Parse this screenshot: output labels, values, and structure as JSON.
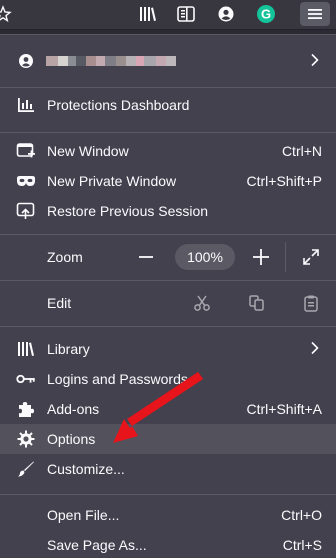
{
  "toolbar": {
    "icons": [
      "star-icon",
      "library-icon",
      "sidebar-icon",
      "account-icon",
      "grammarly-icon",
      "hamburger-menu-icon"
    ],
    "grammarly_letter": "G"
  },
  "menu": {
    "account": {
      "name_redacted": true
    },
    "protections": {
      "label": "Protections Dashboard"
    },
    "new_window": {
      "label": "New Window",
      "shortcut": "Ctrl+N"
    },
    "new_private": {
      "label": "New Private Window",
      "shortcut": "Ctrl+Shift+P"
    },
    "restore": {
      "label": "Restore Previous Session"
    },
    "zoom": {
      "label": "Zoom",
      "value": "100%",
      "minus": "−",
      "plus": "+"
    },
    "edit": {
      "label": "Edit"
    },
    "library": {
      "label": "Library"
    },
    "logins": {
      "label": "Logins and Passwords"
    },
    "addons": {
      "label": "Add-ons",
      "shortcut": "Ctrl+Shift+A"
    },
    "options": {
      "label": "Options"
    },
    "customize": {
      "label": "Customize..."
    },
    "open_file": {
      "label": "Open File...",
      "shortcut": "Ctrl+O"
    },
    "save_page": {
      "label": "Save Page As...",
      "shortcut": "Ctrl+S"
    }
  },
  "colors": {
    "panel_bg": "#42414d",
    "toolbar_bg": "#38373f",
    "highlight": "#53525c",
    "annotation_arrow": "#e8141b",
    "grammarly_green": "#15c39a"
  }
}
